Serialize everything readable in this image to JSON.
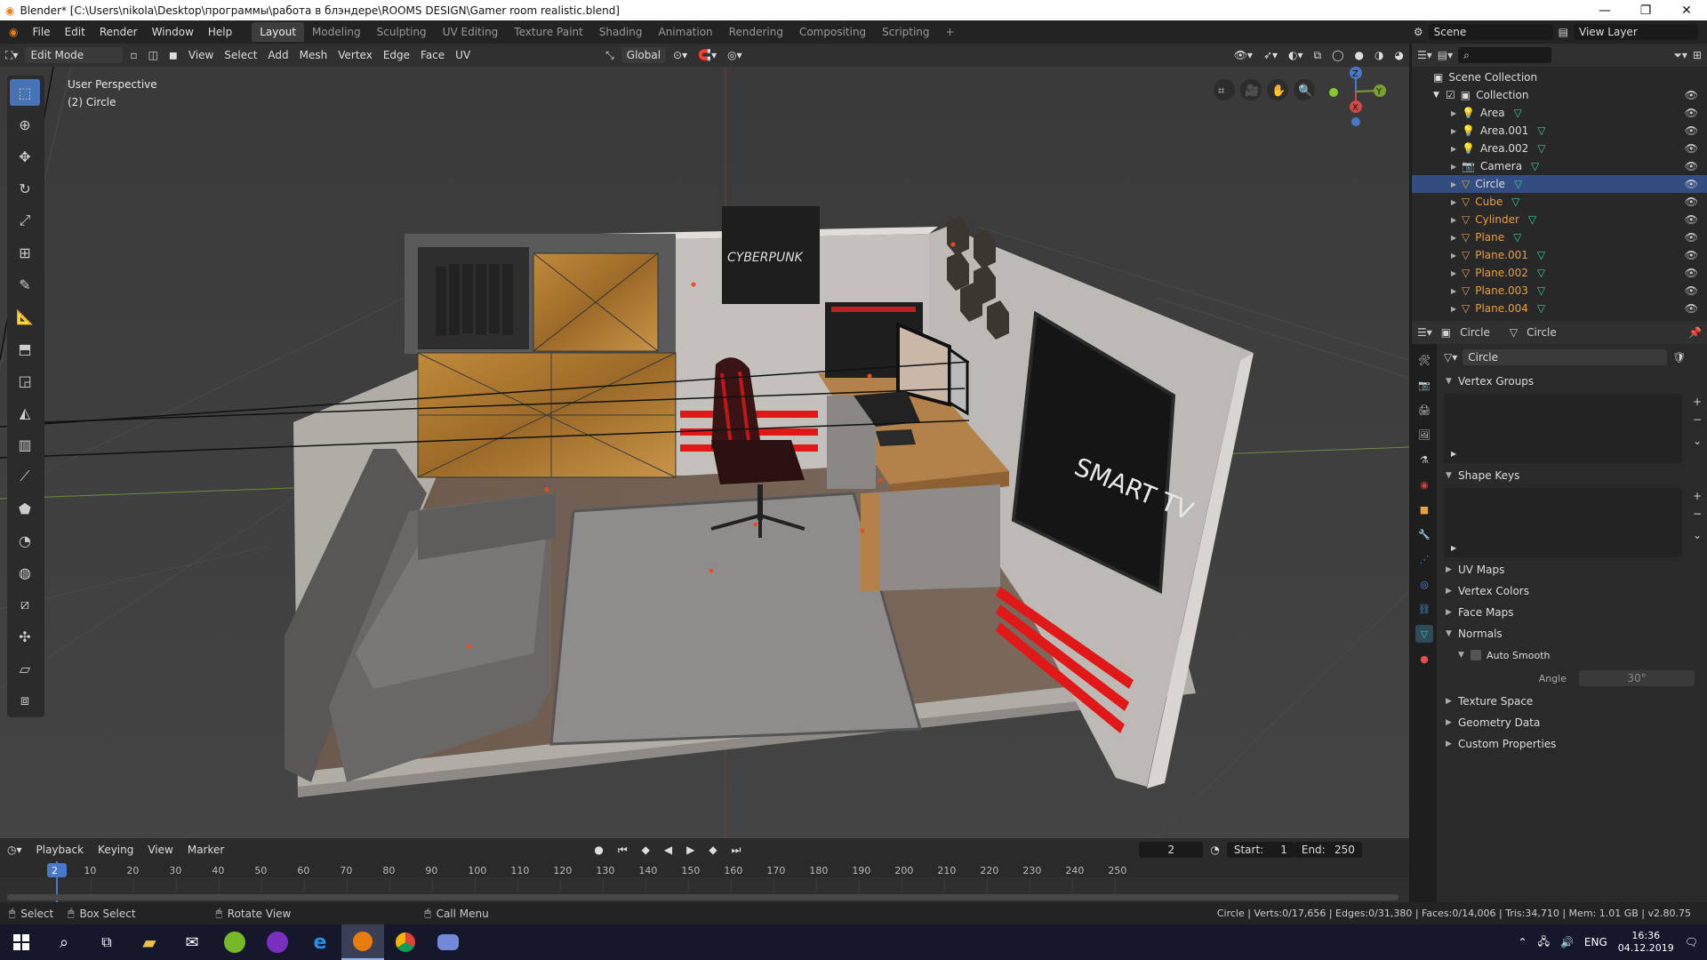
{
  "titlebar": {
    "title": "Blender* [C:\\Users\\nikola\\Desktop\\программы\\работа в блэндере\\ROOMS DESIGN\\Gamer room realistic.blend]",
    "minimize": "—",
    "maximize": "❐",
    "close": "✕"
  },
  "menu": [
    "File",
    "Edit",
    "Render",
    "Window",
    "Help"
  ],
  "workspaces": [
    {
      "label": "Layout",
      "active": true
    },
    {
      "label": "Modeling"
    },
    {
      "label": "Sculpting"
    },
    {
      "label": "UV Editing"
    },
    {
      "label": "Texture Paint"
    },
    {
      "label": "Shading"
    },
    {
      "label": "Animation"
    },
    {
      "label": "Rendering"
    },
    {
      "label": "Compositing"
    },
    {
      "label": "Scripting"
    }
  ],
  "topright": {
    "scene": "Scene",
    "view_layer": "View Layer"
  },
  "viewport_header": {
    "mode": "Edit Mode",
    "menus": [
      "View",
      "Select",
      "Add",
      "Mesh",
      "Vertex",
      "Edge",
      "Face",
      "UV"
    ],
    "orientation": "Global"
  },
  "viewport": {
    "perspective": "User Perspective",
    "object": "(2) Circle"
  },
  "scene_art": {
    "poster_text": "CYBERPUNK",
    "tv_text": "SMART TV"
  },
  "gizmo": {
    "x": "X",
    "y": "Y",
    "z": "Z"
  },
  "outliner": {
    "scene_collection": "Scene Collection",
    "collection": "Collection",
    "items": [
      {
        "name": "Area",
        "type": "light"
      },
      {
        "name": "Area.001",
        "type": "light"
      },
      {
        "name": "Area.002",
        "type": "light"
      },
      {
        "name": "Camera",
        "type": "camera"
      },
      {
        "name": "Circle",
        "type": "mesh",
        "selected": true
      },
      {
        "name": "Cube",
        "type": "mesh"
      },
      {
        "name": "Cylinder",
        "type": "mesh"
      },
      {
        "name": "Plane",
        "type": "mesh"
      },
      {
        "name": "Plane.001",
        "type": "mesh"
      },
      {
        "name": "Plane.002",
        "type": "mesh"
      },
      {
        "name": "Plane.003",
        "type": "mesh"
      },
      {
        "name": "Plane.004",
        "type": "mesh"
      }
    ]
  },
  "properties": {
    "object_name": "Circle",
    "data_name": "Circle",
    "mesh_field": "Circle",
    "panels": {
      "vertex_groups": "Vertex Groups",
      "shape_keys": "Shape Keys",
      "uv_maps": "UV Maps",
      "vertex_colors": "Vertex Colors",
      "face_maps": "Face Maps",
      "normals": "Normals",
      "auto_smooth": "Auto Smooth",
      "angle_label": "Angle",
      "angle_value": "30°",
      "texture_space": "Texture Space",
      "geometry_data": "Geometry Data",
      "custom_properties": "Custom Properties"
    }
  },
  "timeline": {
    "menus": [
      "Playback",
      "Keying",
      "View",
      "Marker"
    ],
    "current_frame": "2",
    "start_label": "Start:",
    "start": "1",
    "end_label": "End:",
    "end": "250",
    "ticks": [
      "10",
      "20",
      "30",
      "40",
      "50",
      "60",
      "70",
      "80",
      "90",
      "100",
      "110",
      "120",
      "130",
      "140",
      "150",
      "160",
      "170",
      "180",
      "190",
      "200",
      "210",
      "220",
      "230",
      "240",
      "250"
    ]
  },
  "statusbar": {
    "select": "Select",
    "box_select": "Box Select",
    "rotate_view": "Rotate View",
    "call_menu": "Call Menu",
    "stats": "Circle | Verts:0/17,656 | Edges:0/31,380 | Faces:0/14,006 | Tris:34,710 | Mem: 1.01 GB | v2.80.75"
  },
  "taskbar": {
    "lang": "ENG",
    "time": "16:36",
    "date": "04.12.2019"
  }
}
